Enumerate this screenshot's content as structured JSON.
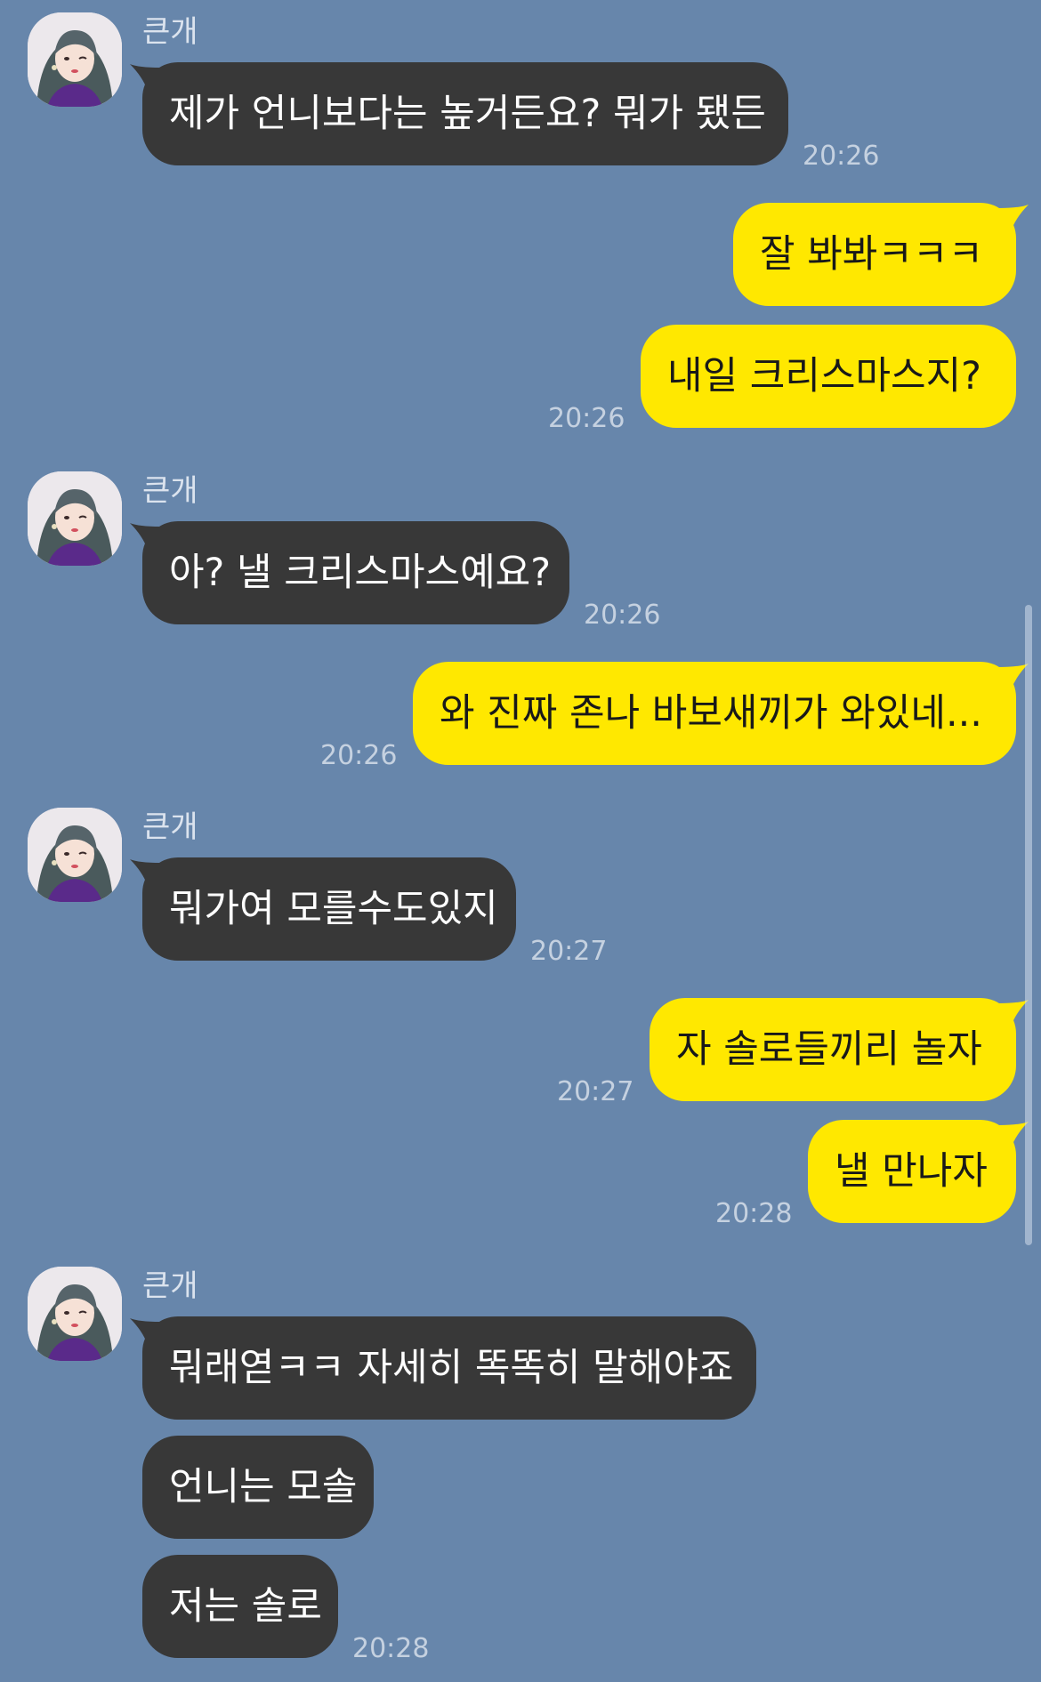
{
  "colors": {
    "background": "#6786ab",
    "incoming_bubble": "#383838",
    "outgoing_bubble": "#ffe800"
  },
  "avatar_icon": "profile-photo",
  "messages": [
    {
      "dir": "in",
      "sender": "큰개",
      "text": "제가 언니보다는 높거든요? 뭐가 됐든",
      "time": "20:26"
    },
    {
      "dir": "out",
      "text": "잘 봐봐ㅋㅋㅋ",
      "time": ""
    },
    {
      "dir": "out",
      "text": "내일 크리스마스지?",
      "time": "20:26"
    },
    {
      "dir": "in",
      "sender": "큰개",
      "text": "아? 낼 크리스마스예요?",
      "time": "20:26"
    },
    {
      "dir": "out",
      "text": "와 진짜 존나 바보새끼가 와있네...",
      "time": "20:26"
    },
    {
      "dir": "in",
      "sender": "큰개",
      "text": "뭐가여 모를수도있지",
      "time": "20:27"
    },
    {
      "dir": "out",
      "text": "자 솔로들끼리 놀자",
      "time": "20:27"
    },
    {
      "dir": "out",
      "text": "낼 만나자",
      "time": "20:28"
    },
    {
      "dir": "in",
      "sender": "큰개",
      "text": "뭐래엳ㅋㅋ 자세히 똑똑히 말해야죠",
      "time": ""
    },
    {
      "dir": "in",
      "text": "언니는 모솔",
      "time": ""
    },
    {
      "dir": "in",
      "text": "저는 솔로",
      "time": "20:28"
    }
  ]
}
